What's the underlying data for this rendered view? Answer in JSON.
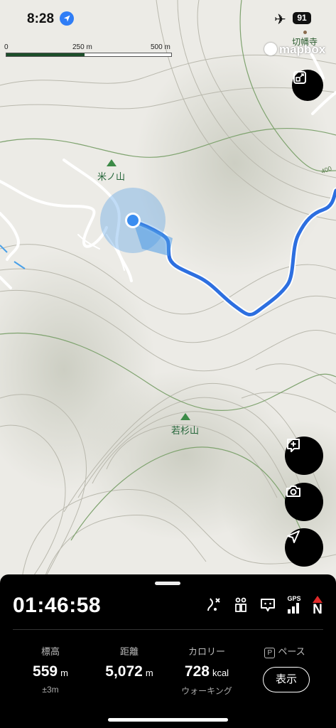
{
  "status": {
    "time": "8:28",
    "battery": "91"
  },
  "scale": {
    "labels": [
      "0",
      "250 m",
      "500 m"
    ]
  },
  "map": {
    "attribution": "mapbox",
    "poi_label": "切幡寺",
    "peaks": [
      "米ノ山",
      "若杉山"
    ],
    "contour_label": "400"
  },
  "panel": {
    "elapsed": "01:46:58",
    "gps_label": "GPS",
    "compass_label": "N",
    "stats": [
      {
        "key": "標高",
        "value": "559",
        "unit": "m",
        "sub": "±3m"
      },
      {
        "key": "距離",
        "value": "5,072",
        "unit": "m",
        "sub": ""
      },
      {
        "key": "カロリー",
        "value": "728",
        "unit": "kcal",
        "sub": "ウォーキング"
      }
    ],
    "pace_badge": "P",
    "pace_label": "ペース",
    "show_button": "表示"
  },
  "colors": {
    "track": "#2d6fe0",
    "location": "#3a8df0",
    "panel_bg": "#000000"
  }
}
